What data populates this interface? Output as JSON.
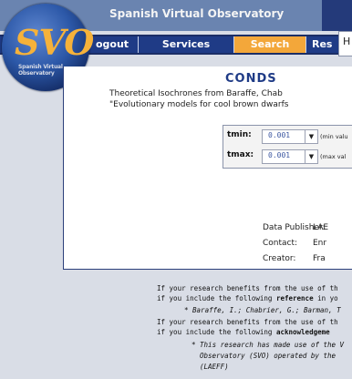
{
  "header": {
    "title": "Spanish Virtual Observatory"
  },
  "logo": {
    "text": "SVO",
    "subtitle": "Spanish Virtual Observatory"
  },
  "nav": {
    "items": [
      {
        "label": "ogout"
      },
      {
        "label": "Services"
      },
      {
        "label": "Search"
      },
      {
        "label": "Res"
      }
    ],
    "partial_tab": "H"
  },
  "page": {
    "heading": "CONDS",
    "desc_line1": "Theoretical Isochrones from Baraffe, Chab",
    "desc_line2": "\"Evolutionary models for cool brown dwarfs"
  },
  "form": {
    "tmin": {
      "label": "tmin:",
      "value": "0.001",
      "hint": "(min valu"
    },
    "tmax": {
      "label": "tmax:",
      "value": "0.001",
      "hint": "(max val"
    }
  },
  "meta": {
    "publisher": {
      "label": "Data Publisher:",
      "value": "LAE"
    },
    "contact": {
      "label": "Contact:",
      "value": "Enr"
    },
    "creator": {
      "label": "Creator:",
      "value": "Fra"
    }
  },
  "footer": {
    "l1": "If your research benefits from the use of th",
    "l2a": "if you include the following ",
    "l2b": "reference",
    "l2c": " in yo",
    "l3": "* Baraffe, I.; Chabrier, G.; Barman, T",
    "l4": "If your research benefits from the use of th",
    "l5a": "if you include the following ",
    "l5b": "acknowledgeme",
    "l6": "* This research has made use of the V",
    "l7": "Observatory (SVO) operated by the",
    "l8": "(LAEFF)"
  }
}
